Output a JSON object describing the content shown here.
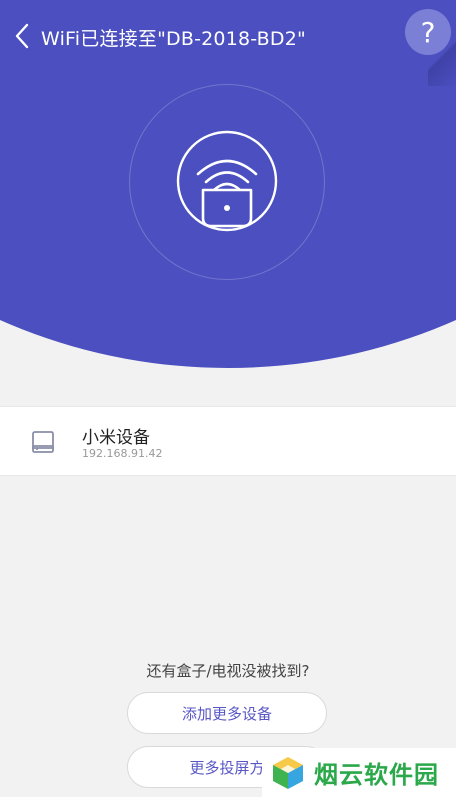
{
  "colors": {
    "hero": "#4b4fbf",
    "accent": "#5857c4",
    "help_bg": "#7c7fd6",
    "watermark_green": "#2aa84a"
  },
  "header": {
    "title": "WiFi已连接至\"DB-2018-BD2\"",
    "back_icon": "chevron-left-icon",
    "help_label": "?"
  },
  "hero": {
    "icon": "wifi-cast-icon"
  },
  "devices": [
    {
      "icon": "tv-box-icon",
      "name": "小米设备",
      "ip": "192.168.91.42"
    }
  ],
  "footer": {
    "prompt": "还有盒子/电视没被找到?",
    "add_button": "添加更多设备",
    "more_button": "更多投屏方"
  },
  "watermark": {
    "text": "烟云软件园"
  }
}
